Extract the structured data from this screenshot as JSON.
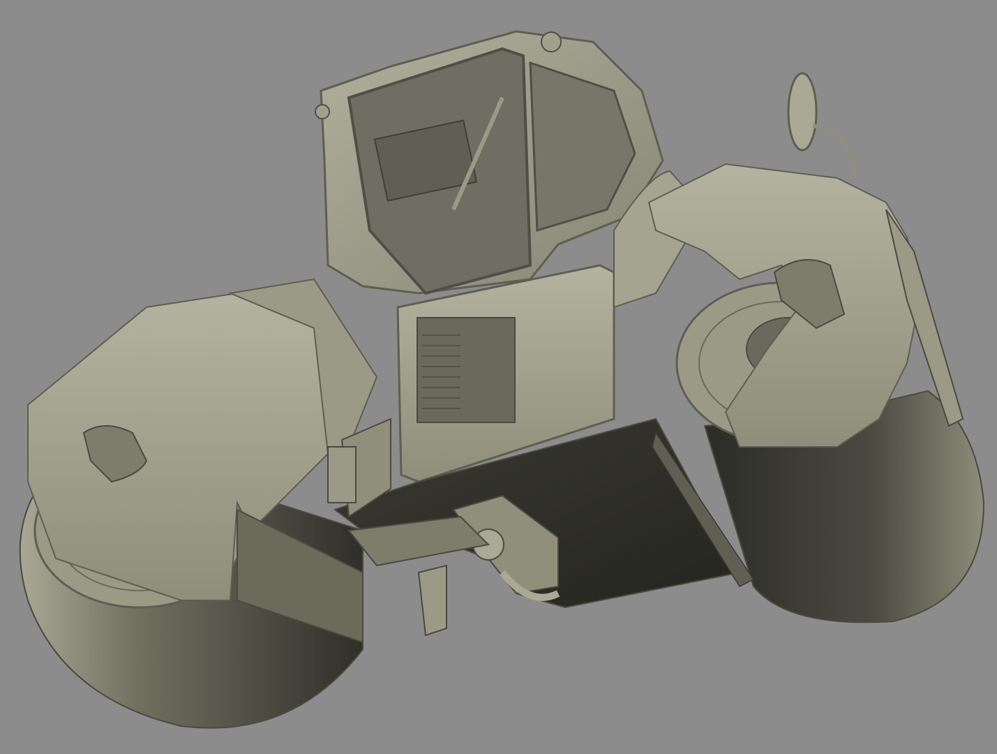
{
  "scene": {
    "subject": "tandem-roller-3d-render",
    "background_color": "#8c8c8c",
    "colors": {
      "body_light": "#a9a996",
      "body_mid": "#8f8f7c",
      "body_dark": "#4a4a40",
      "shadow": "#2e2e28",
      "drum_highlight": "#7d7d6c",
      "edge_line": "#5e5e52",
      "glass": "#6e6e62"
    }
  }
}
